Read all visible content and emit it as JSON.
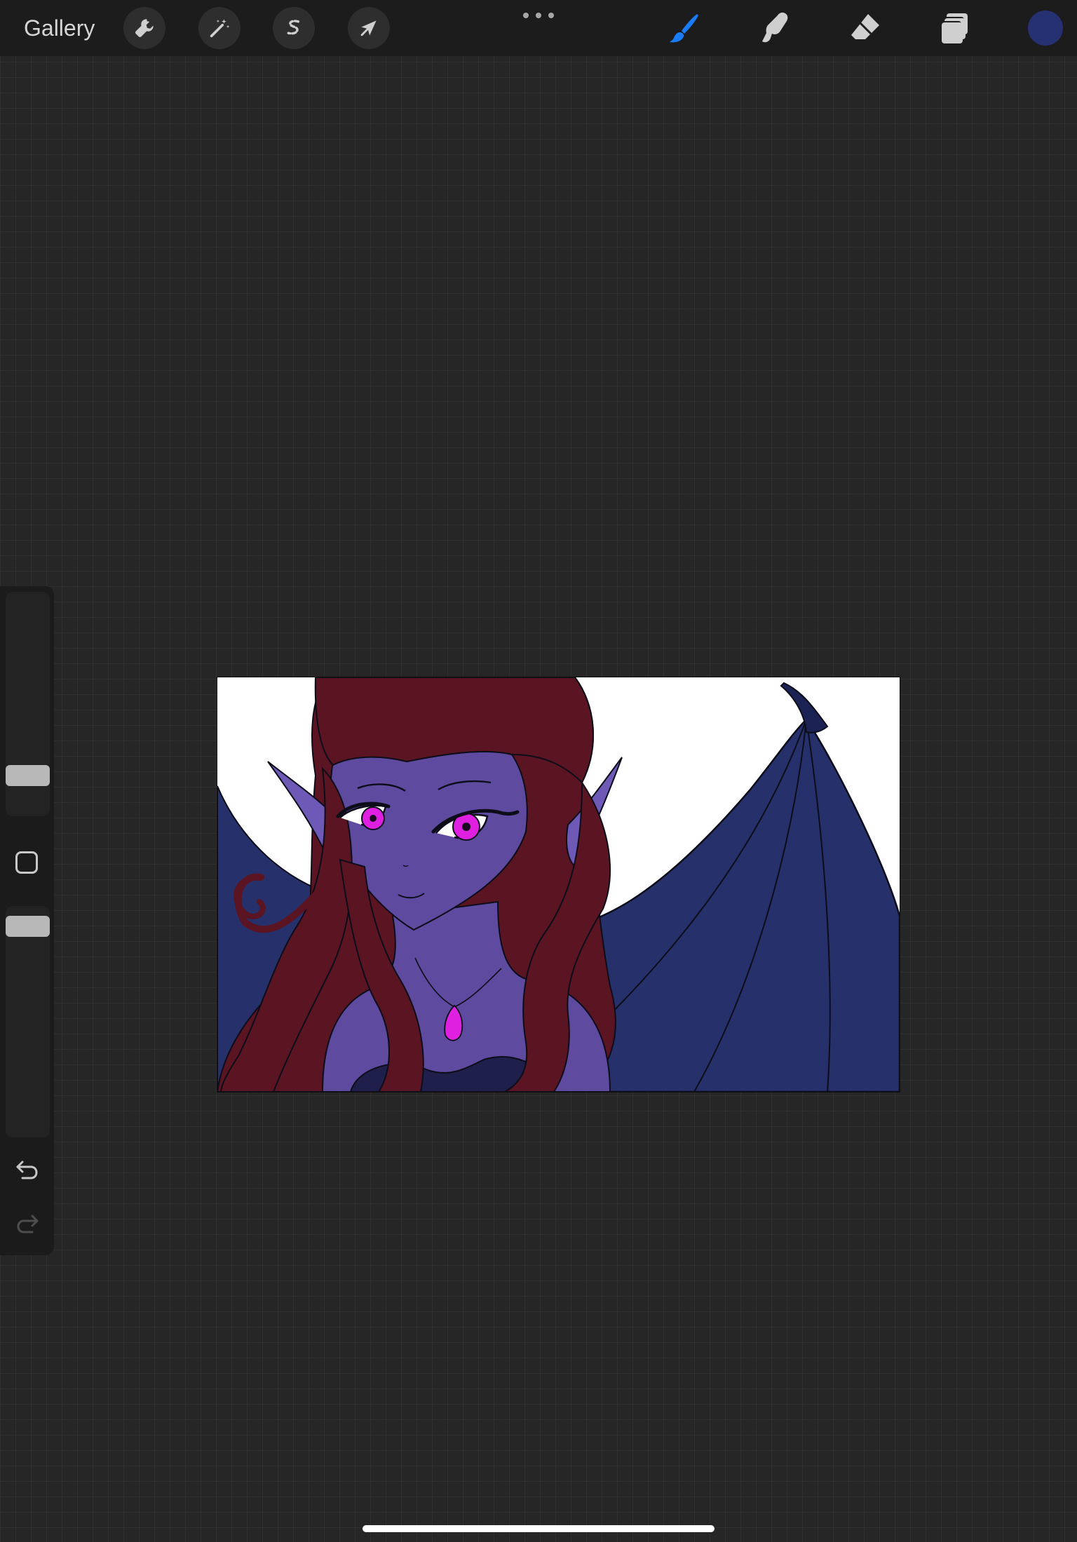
{
  "toolbar": {
    "gallery_label": "Gallery",
    "left_tools": [
      {
        "name": "actions",
        "icon": "wrench-icon"
      },
      {
        "name": "adjustments",
        "icon": "magic-wand-icon"
      },
      {
        "name": "selection",
        "icon": "selection-s-icon"
      },
      {
        "name": "transform",
        "icon": "arrow-cursor-icon"
      }
    ],
    "more_icon": "ellipsis-icon",
    "right_tools": [
      {
        "name": "brush",
        "icon": "brush-icon",
        "active": true
      },
      {
        "name": "smudge",
        "icon": "smudge-finger-icon",
        "active": false
      },
      {
        "name": "eraser",
        "icon": "eraser-icon",
        "active": false
      },
      {
        "name": "layers",
        "icon": "layers-icon",
        "active": false
      }
    ],
    "current_color": "#263174",
    "active_tool_color": "#1a7cf5"
  },
  "sidebar": {
    "brush_size_icon": "size-slider",
    "modify_icon": "square-icon",
    "opacity_icon": "opacity-slider",
    "undo_icon": "undo-icon",
    "redo_icon": "redo-icon"
  },
  "canvas": {
    "background": "#ffffff",
    "colors": {
      "hair": "#5a1422",
      "skin": "#5e4a9f",
      "wing": "#26306a",
      "eyes": "#e020e0",
      "outline": "#0d0d1a"
    }
  }
}
